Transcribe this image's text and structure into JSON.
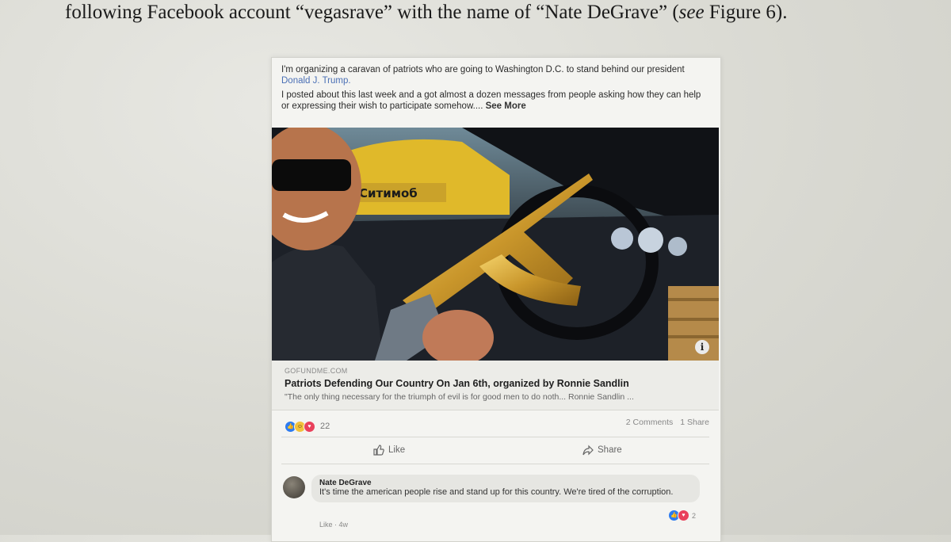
{
  "document": {
    "line_before": "following Facebook account “vegasrave” with the name of “Nate DeGrave” (",
    "line_em": "see",
    "line_after": " Figure 6)."
  },
  "post": {
    "text_line1": "I'm organizing a caravan of patriots who are going to Washington D.C. to stand behind our president ",
    "mention": "Donald J. Trump.",
    "text_line2": "I posted about this last week and a got almost a dozen messages from people asking how they can help or expressing their wish to participate somehow.... ",
    "see_more": "See More",
    "photo_sign_text": "Ситимоб",
    "info_icon": "i",
    "link_domain": "GOFUNDME.COM",
    "link_title": "Patriots Defending Our Country On Jan 6th, organized by Ronnie Sandlin",
    "link_desc": "\"The only thing necessary for the triumph of evil is for good men to do noth... Ronnie Sandlin ...",
    "reaction_count": "22",
    "comments_count": "2 Comments",
    "shares_count": "1 Share",
    "like_label": "Like",
    "share_label": "Share"
  },
  "comment": {
    "author": "Nate DeGrave",
    "text": "It's time the american people rise and stand up for this country. We're tired of the corruption.",
    "reaction_count": "2",
    "actions": "Like · 4w"
  },
  "colors": {
    "mention_blue": "#4a6fb5",
    "like_blue": "#2d7bf0",
    "love_red": "#e9405b",
    "haha_yellow": "#f3c13a"
  }
}
